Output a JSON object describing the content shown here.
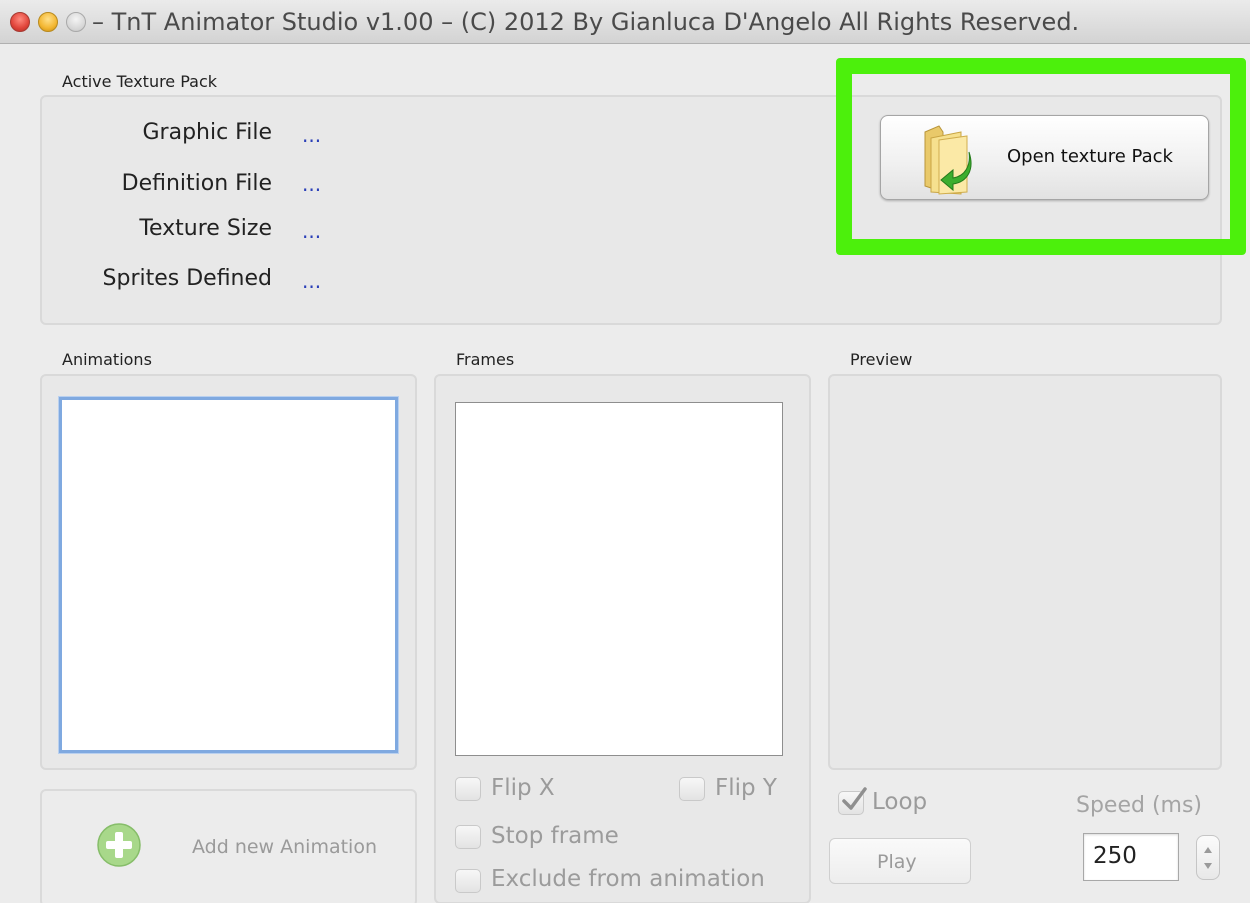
{
  "window": {
    "title": "– TnT Animator Studio v1.00 – (C) 2012 By Gianluca D'Angelo All Rights Reserved."
  },
  "texture_pack": {
    "group_label": "Active Texture Pack",
    "fields": [
      {
        "label": "Graphic File",
        "value": "..."
      },
      {
        "label": "Definition File",
        "value": "..."
      },
      {
        "label": "Texture Size",
        "value": "..."
      },
      {
        "label": "Sprites Defined",
        "value": "..."
      }
    ],
    "open_button_label": "Open texture Pack",
    "highlight_color": "#4cf00c"
  },
  "animations": {
    "group_label": "Animations",
    "add_button_label": "Add new Animation"
  },
  "frames": {
    "group_label": "Frames",
    "flip_x_label": "Flip X",
    "flip_y_label": "Flip Y",
    "stop_frame_label": "Stop frame",
    "exclude_label": "Exclude from animation"
  },
  "preview": {
    "group_label": "Preview",
    "loop_label": "Loop",
    "loop_checked": true,
    "speed_label": "Speed (ms)",
    "speed_value": "250",
    "play_button_label": "Play"
  }
}
